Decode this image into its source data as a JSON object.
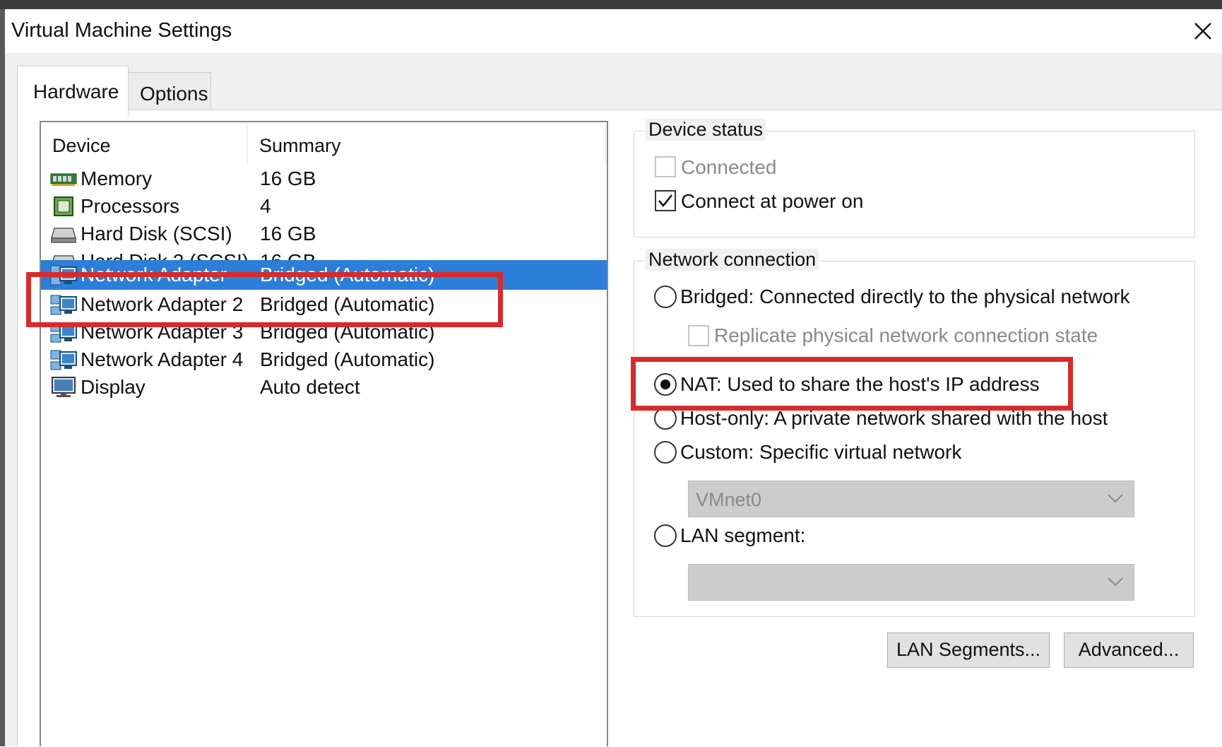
{
  "window": {
    "title": "Virtual Machine Settings"
  },
  "tabs": [
    {
      "label": "Hardware",
      "active": true
    },
    {
      "label": "Options",
      "active": false
    }
  ],
  "device_list": {
    "headers": {
      "device": "Device",
      "summary": "Summary"
    },
    "rows": [
      {
        "name": "Memory",
        "summary": "16 GB",
        "icon": "memory-icon"
      },
      {
        "name": "Processors",
        "summary": "4",
        "icon": "processor-icon"
      },
      {
        "name": "Hard Disk (SCSI)",
        "summary": "16 GB",
        "icon": "hard-disk-icon"
      },
      {
        "name": "Hard Disk 2 (SCSI)",
        "summary": "16 GB",
        "icon": "hard-disk-icon"
      },
      {
        "name": "Network Adapter",
        "summary": "Bridged (Automatic)",
        "icon": "network-adapter-icon",
        "selected": true
      },
      {
        "name": "Network Adapter 2",
        "summary": "Bridged (Automatic)",
        "icon": "network-adapter-icon"
      },
      {
        "name": "Network Adapter 3",
        "summary": "Bridged (Automatic)",
        "icon": "network-adapter-icon"
      },
      {
        "name": "Network Adapter 4",
        "summary": "Bridged (Automatic)",
        "icon": "network-adapter-icon"
      },
      {
        "name": "Display",
        "summary": "Auto detect",
        "icon": "display-icon"
      }
    ]
  },
  "device_status": {
    "legend": "Device status",
    "connected": {
      "label": "Connected",
      "checked": false,
      "enabled": false
    },
    "connect_at_power_on": {
      "label": "Connect at power on",
      "checked": true,
      "enabled": true
    }
  },
  "network_connection": {
    "legend": "Network connection",
    "bridged": {
      "label": "Bridged: Connected directly to the physical network",
      "selected": false
    },
    "replicate": {
      "label": "Replicate physical network connection state",
      "checked": false,
      "enabled": false
    },
    "nat": {
      "label": "NAT: Used to share the host's IP address",
      "selected": true
    },
    "host_only": {
      "label": "Host-only: A private network shared with the host",
      "selected": false
    },
    "custom": {
      "label": "Custom: Specific virtual network",
      "selected": false
    },
    "custom_network_select": {
      "value": "VMnet0",
      "enabled": false
    },
    "lan_segment": {
      "label": "LAN segment:",
      "selected": false
    },
    "lan_segment_select": {
      "value": "",
      "enabled": false
    }
  },
  "buttons": {
    "lan_segments": "LAN Segments...",
    "advanced": "Advanced..."
  },
  "colors": {
    "selection": "#2c7fd9",
    "highlight": "#d62b2b",
    "dialog_bg": "#f0f0f0"
  }
}
